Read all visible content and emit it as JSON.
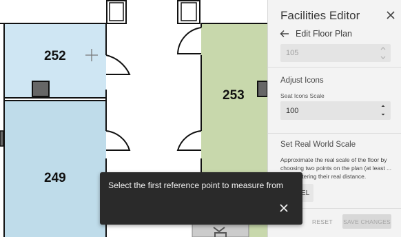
{
  "floor_plan": {
    "rooms": [
      {
        "number": "252"
      },
      {
        "number": "249"
      },
      {
        "number": "253"
      }
    ],
    "colors": {
      "room_blue": "#cfe6f3",
      "room_green": "#c8d8ac",
      "wall": "#111111"
    }
  },
  "panel": {
    "title": "Facilities Editor",
    "subtitle": "Edit Floor Plan",
    "top_field": {
      "value": "105"
    },
    "adjust_icons": {
      "heading": "Adjust Icons",
      "seat_scale_label": "Seat Icons Scale",
      "seat_scale_value": "100"
    },
    "real_world": {
      "heading": "Set Real World Scale",
      "description": "Approximate the real scale of the floor by choosing two points on the plan (at least ... ) and entering their real distance.",
      "partial_button": "EL"
    },
    "reset_label": "RESET",
    "save_label": "SAVE CHANGES"
  },
  "snackbar": {
    "message": "Select the first reference point to measure from"
  }
}
